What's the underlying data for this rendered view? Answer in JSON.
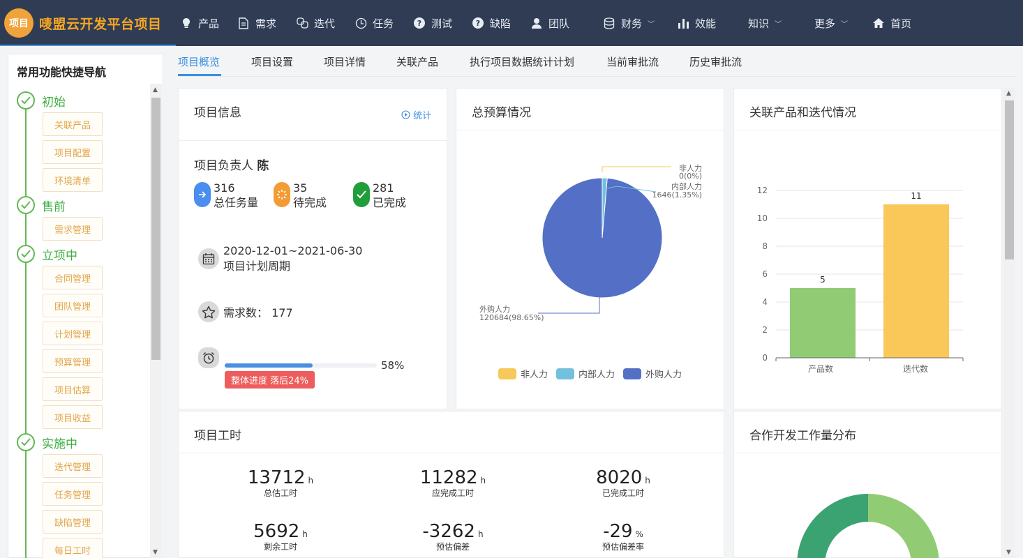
{
  "brand": {
    "badge": "项目",
    "title": "唛盟云开发平台项目"
  },
  "nav": [
    {
      "label": "产品",
      "icon": "bulb-icon"
    },
    {
      "label": "需求",
      "icon": "document-icon"
    },
    {
      "label": "迭代",
      "icon": "iteration-icon"
    },
    {
      "label": "任务",
      "icon": "clock-icon"
    },
    {
      "label": "测试",
      "icon": "question-icon"
    },
    {
      "label": "缺陷",
      "icon": "question-icon"
    },
    {
      "label": "团队",
      "icon": "user-icon"
    },
    {
      "label": "财务",
      "icon": "database-icon"
    },
    {
      "label": "效能",
      "icon": "bar-chart-icon"
    },
    {
      "label": "知识",
      "icon": ""
    },
    {
      "label": "更多",
      "icon": ""
    },
    {
      "label": "首页",
      "icon": "home-icon"
    }
  ],
  "sidebar": {
    "title": "常用功能快捷导航",
    "stages": [
      {
        "label": "初始",
        "items": [
          "关联产品",
          "项目配置",
          "环境清单"
        ]
      },
      {
        "label": "售前",
        "items": [
          "需求管理"
        ]
      },
      {
        "label": "立项中",
        "items": [
          "合同管理",
          "团队管理",
          "计划管理",
          "预算管理",
          "项目估算",
          "项目收益"
        ]
      },
      {
        "label": "实施中",
        "items": [
          "迭代管理",
          "任务管理",
          "缺陷管理",
          "每日工时"
        ]
      }
    ]
  },
  "tabs": [
    "项目概览",
    "项目设置",
    "项目详情",
    "关联产品",
    "执行项目数据统计计划",
    "当前审批流",
    "历史审批流"
  ],
  "project_info": {
    "title": "项目信息",
    "stat_link": "统计",
    "owner_label": "项目负责人",
    "owner_name": "陈",
    "kpis": [
      {
        "value": "316",
        "label": "总任务量",
        "color": "#4a8ef0"
      },
      {
        "value": "35",
        "label": "待完成",
        "color": "#f39c34"
      },
      {
        "value": "281",
        "label": "已完成",
        "color": "#1f9e3a"
      }
    ],
    "period_value": "2020-12-01~2021-06-30",
    "period_label": "项目计划周期",
    "demand_text": "需求数：  177",
    "progress": 0.58,
    "progress_text": "58%",
    "lag_badge": "整体进度 落后24%"
  },
  "budget": {
    "title": "总预算情况",
    "legend": [
      "非人力",
      "内部人力",
      "外购人力"
    ],
    "colors": {
      "non_labor": "#f7c85a",
      "internal": "#73c0de",
      "external": "#5470c6"
    },
    "label_nonlabor_name": "非人力",
    "label_nonlabor_val": "0(0%)",
    "label_internal_name": "内部人力",
    "label_internal_val": "1646(1.35%)",
    "label_external_name": "外购人力",
    "label_external_val": "120684(98.65%)"
  },
  "related": {
    "title": "关联产品和迭代情况",
    "y_ticks": [
      "0",
      "2",
      "4",
      "6",
      "8",
      "10",
      "12"
    ],
    "value_labels": [
      "5",
      "11"
    ],
    "category_labels": [
      "产品数",
      "迭代数"
    ]
  },
  "chart_data": [
    {
      "type": "pie",
      "title": "总预算情况",
      "categories": [
        "非人力",
        "内部人力",
        "外购人力"
      ],
      "values": [
        0,
        1646,
        120684
      ],
      "percents": [
        0,
        1.35,
        98.65
      ],
      "legend": "bottom"
    },
    {
      "type": "bar",
      "title": "关联产品和迭代情况",
      "categories": [
        "产品数",
        "迭代数"
      ],
      "values": [
        5,
        11
      ],
      "colors": [
        "#91cc75",
        "#fac858"
      ],
      "ylim": [
        0,
        12
      ],
      "grid": true
    }
  ],
  "work_hours": {
    "title": "项目工时",
    "items": [
      {
        "value": "13712",
        "unit": "h",
        "label": "总估工时"
      },
      {
        "value": "11282",
        "unit": "h",
        "label": "应完成工时"
      },
      {
        "value": "8020",
        "unit": "h",
        "label": "已完成工时"
      },
      {
        "value": "5692",
        "unit": "h",
        "label": "剩余工时"
      },
      {
        "value": "-3262",
        "unit": "h",
        "label": "预估偏差"
      },
      {
        "value": "-29",
        "unit": "%",
        "label": "预估偏差率"
      }
    ]
  },
  "coop": {
    "title": "合作开发工作量分布"
  }
}
